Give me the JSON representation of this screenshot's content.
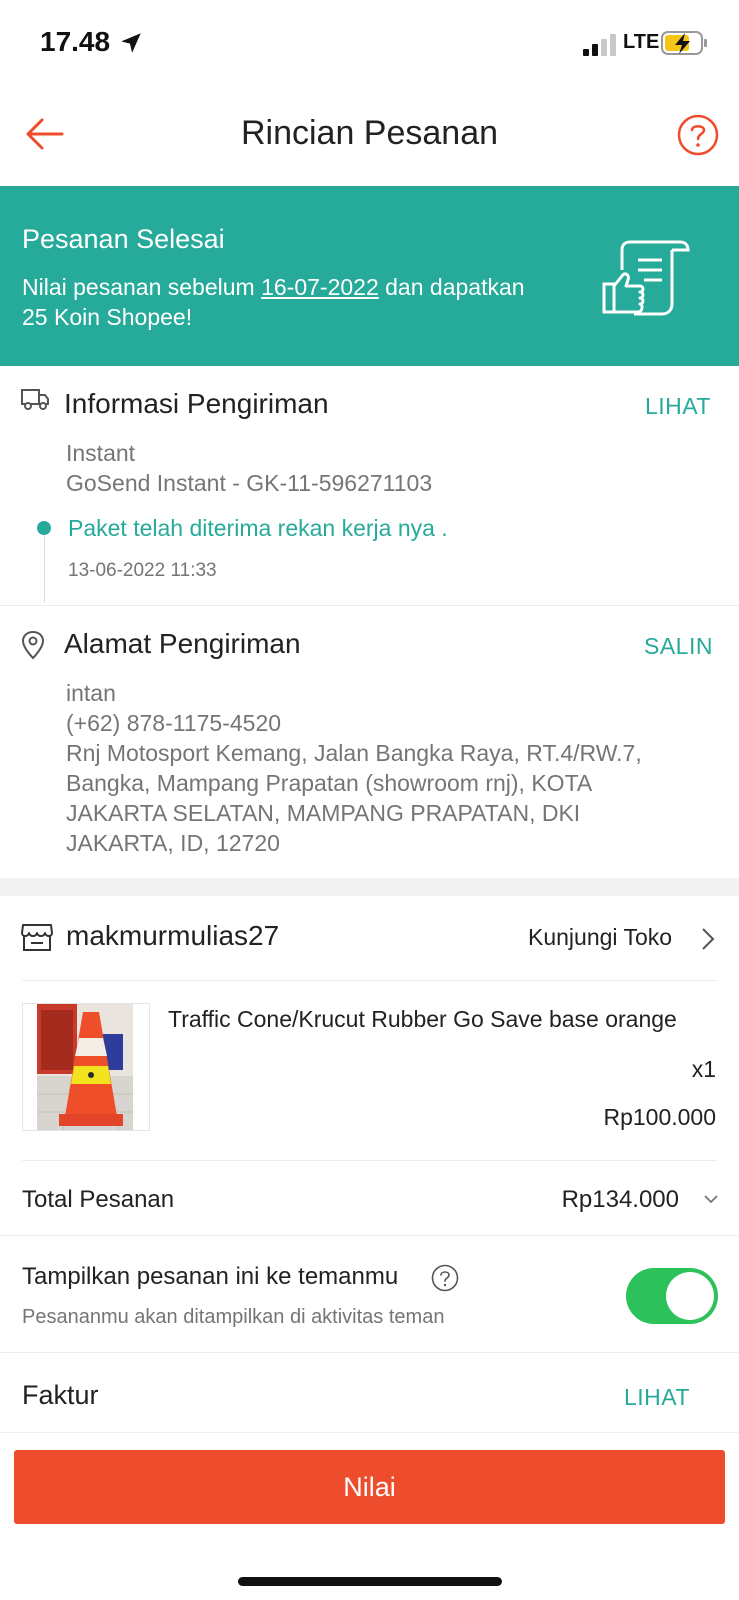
{
  "status_bar": {
    "time": "17.48",
    "network": "LTE",
    "icons": [
      "location-arrow-icon",
      "signal-icon",
      "battery-charging-icon"
    ]
  },
  "header": {
    "title": "Rincian Pesanan",
    "back_icon": "arrow-left-icon",
    "help_icon": "question-circle-icon"
  },
  "banner": {
    "title": "Pesanan Selesai",
    "text_before": "Nilai pesanan sebelum ",
    "date": "16-07-2022",
    "text_after": " dan dapatkan 25 Koin Shopee!",
    "icon": "receipt-thumbs-up-icon"
  },
  "shipping": {
    "title": "Informasi Pengiriman",
    "action": "LIHAT",
    "service": "Instant",
    "courier": "GoSend Instant - GK-11-596271103",
    "status": "Paket telah diterima rekan kerja nya .",
    "timestamp": "13-06-2022 11:33",
    "icon": "truck-icon"
  },
  "address": {
    "title": "Alamat Pengiriman",
    "action": "SALIN",
    "name": "intan",
    "phone": "(+62) 878-1175-4520",
    "lines": [
      "Rnj Motosport Kemang, Jalan Bangka Raya, RT.4/RW.7,",
      "Bangka, Mampang Prapatan (showroom rnj), KOTA",
      "JAKARTA SELATAN, MAMPANG PRAPATAN, DKI",
      "JAKARTA, ID, 12720"
    ],
    "icon": "location-pin-icon"
  },
  "shop": {
    "name": "makmurmulias27",
    "visit": "Kunjungi Toko",
    "icon": "store-icon"
  },
  "product": {
    "name": "Traffic Cone/Krucut Rubber Go Save base orange",
    "quantity": "x1",
    "price": "Rp100.000"
  },
  "total": {
    "label": "Total Pesanan",
    "value": "Rp134.000"
  },
  "share": {
    "label": "Tampilkan pesanan ini ke temanmu",
    "subtitle": "Pesananmu akan ditampilkan di aktivitas teman",
    "enabled": true
  },
  "invoice": {
    "label": "Faktur",
    "action": "LIHAT"
  },
  "footer": {
    "button": "Nilai"
  },
  "colors": {
    "brand": "#ee4d2d",
    "teal": "#26aa99",
    "toggle_on": "#2cc15b"
  }
}
